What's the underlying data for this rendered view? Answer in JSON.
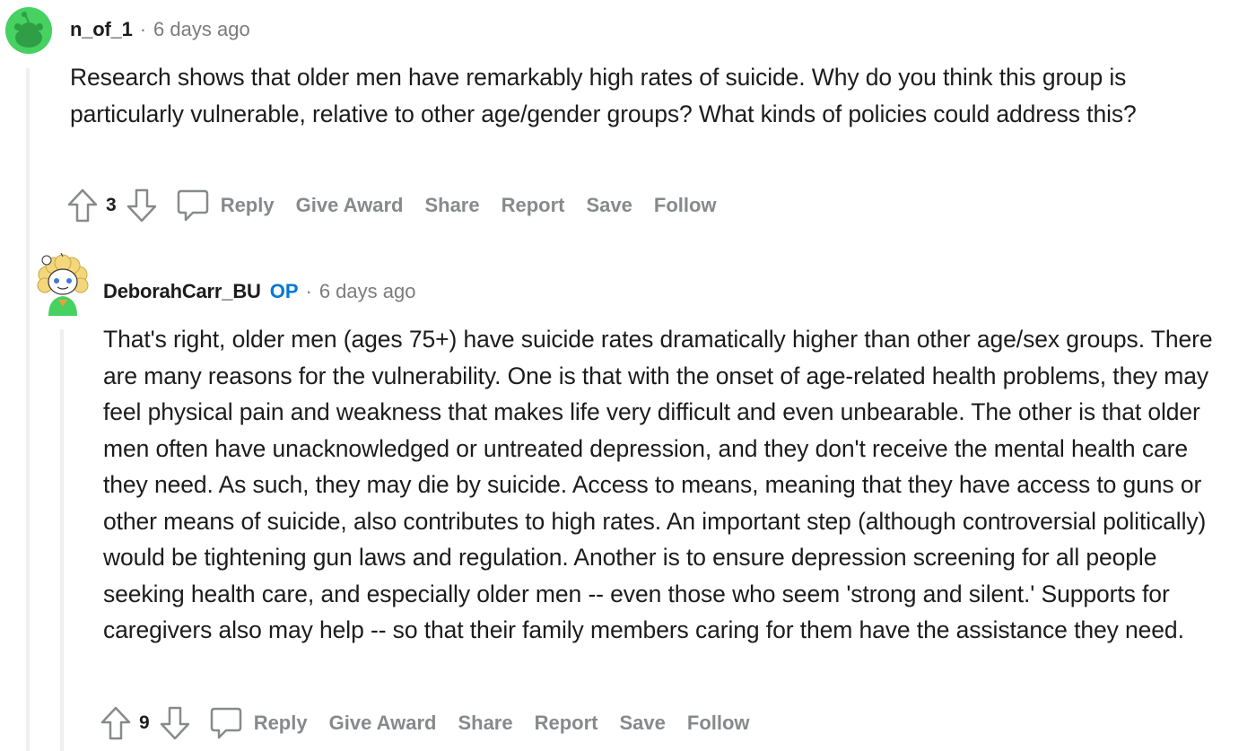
{
  "comments": [
    {
      "author": "n_of_1",
      "op_badge": "",
      "separator": "·",
      "time": "6 days ago",
      "body": "Research shows that older men have remarkably high rates of suicide. Why do you think this group is particularly vulnerable, relative to other age/gender groups? What kinds of policies could address this?",
      "score": "3",
      "actions": {
        "reply": "Reply",
        "award": "Give Award",
        "share": "Share",
        "report": "Report",
        "save": "Save",
        "follow": "Follow"
      }
    },
    {
      "author": "DeborahCarr_BU",
      "op_badge": "OP",
      "separator": "·",
      "time": "6 days ago",
      "body": "That's right, older men (ages 75+) have suicide rates dramatically higher than other age/sex groups. There are many reasons for the vulnerability. One is that with the onset of age-related health problems, they may feel physical pain and weakness that makes life very difficult and even unbearable. The other is that older men often have unacknowledged or untreated depression, and they don't receive the mental health care they need. As such, they may die by suicide. Access to means, meaning that they have access to guns or other means of suicide, also contributes to high rates. An important step (although controversial politically) would be tightening gun laws and regulation. Another is to ensure depression screening for all people seeking health care, and especially older men -- even those who seem 'strong and silent.' Supports for caregivers also may help -- so that their family members caring for them have the assistance they need.",
      "score": "9",
      "actions": {
        "reply": "Reply",
        "award": "Give Award",
        "share": "Share",
        "report": "Report",
        "save": "Save",
        "follow": "Follow"
      }
    }
  ],
  "icons": {
    "upvote": "upvote-arrow-icon",
    "downvote": "downvote-arrow-icon",
    "reply": "speech-bubble-icon"
  },
  "colors": {
    "op_badge": "#0079d3",
    "meta_gray": "#7c7c7c",
    "action_gray": "#878a8c",
    "thread_line": "#edeff1",
    "avatar_green": "#46d160"
  }
}
